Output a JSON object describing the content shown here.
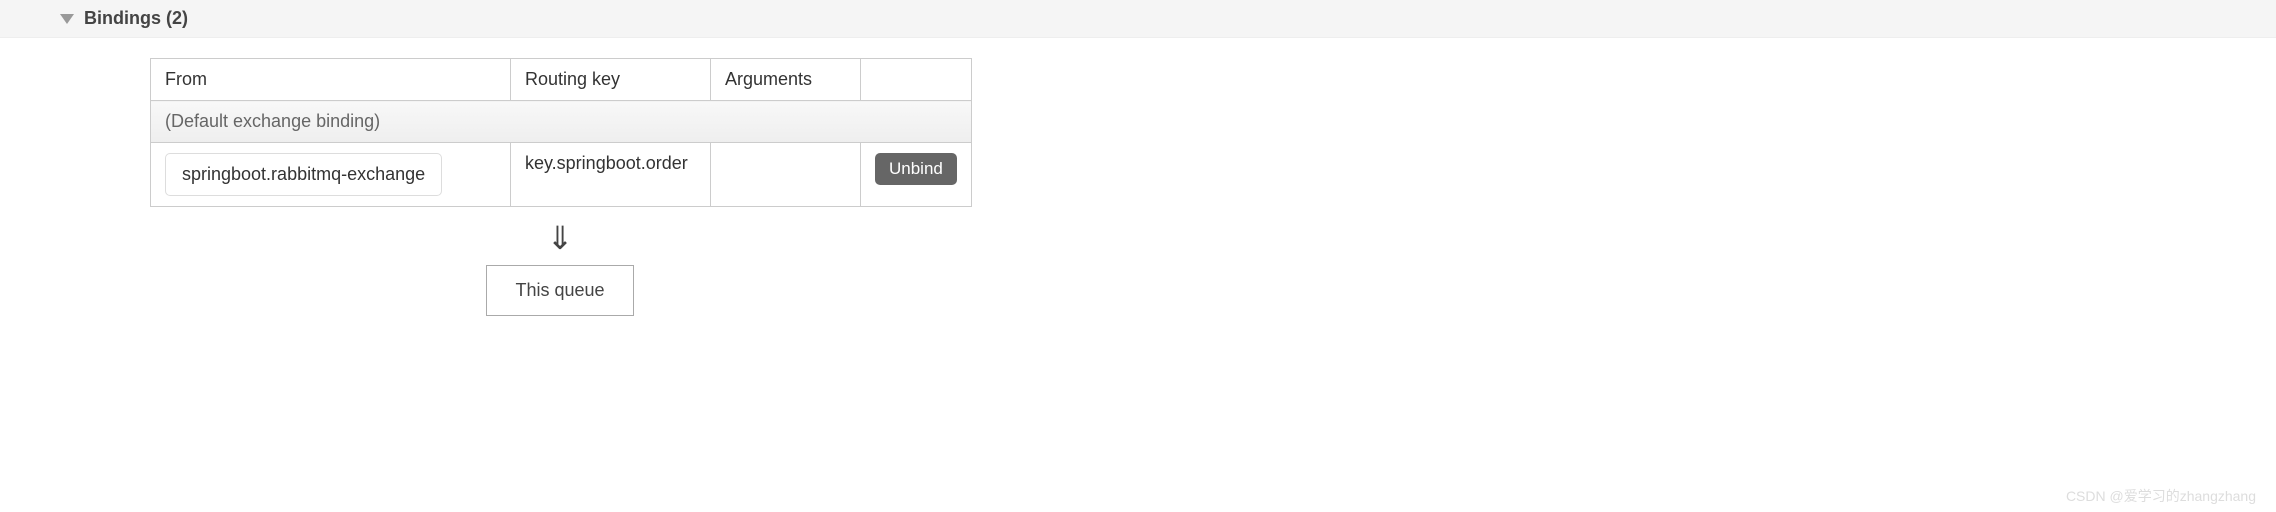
{
  "section": {
    "title": "Bindings (2)"
  },
  "table": {
    "headers": {
      "from": "From",
      "routing_key": "Routing key",
      "arguments": "Arguments"
    },
    "default_row": "(Default exchange binding)",
    "rows": [
      {
        "from": "springboot.rabbitmq-exchange",
        "routing_key": "key.springboot.order",
        "arguments": "",
        "action_label": "Unbind"
      }
    ]
  },
  "arrow_glyph": "⇓",
  "queue_box": "This queue",
  "watermark": "CSDN @爱学习的zhangzhang"
}
